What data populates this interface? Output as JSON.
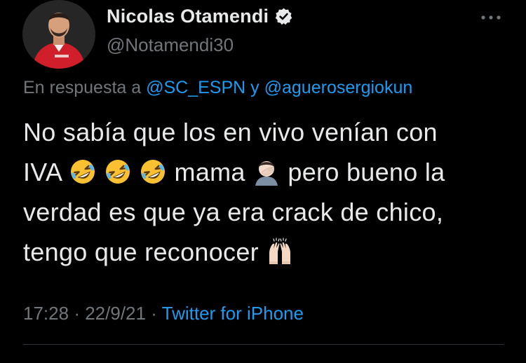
{
  "user": {
    "display_name": "Nicolas Otamendi",
    "handle": "@Notamendi30",
    "verified": true
  },
  "reply": {
    "prefix": "En respuesta a",
    "mention_1": "@SC_ESPN",
    "connector": "y",
    "mention_2": "@aguerosergiokun"
  },
  "tweet": {
    "line1": "No sabía que los en vivo venían con",
    "line2_a": "IVA",
    "line2_b": "mama",
    "line2_c": "pero bueno la",
    "line3": "verdad es que ya era crack de chico,",
    "line4": "tengo que reconocer",
    "emojis": [
      "rolling-on-floor-laughing",
      "rolling-on-floor-laughing",
      "rolling-on-floor-laughing",
      "man-facepalming",
      "raising-hands"
    ]
  },
  "meta": {
    "time": "17:28",
    "separator": "·",
    "date": "22/9/21",
    "source": "Twitter for iPhone"
  },
  "icons": {
    "more": "more-horizontal-icon",
    "verified": "verified-badge-icon"
  },
  "colors": {
    "background": "#000000",
    "text": "#e7e9ea",
    "secondary": "#71767b",
    "link": "#1d9bf0",
    "divider": "#2f3336"
  }
}
